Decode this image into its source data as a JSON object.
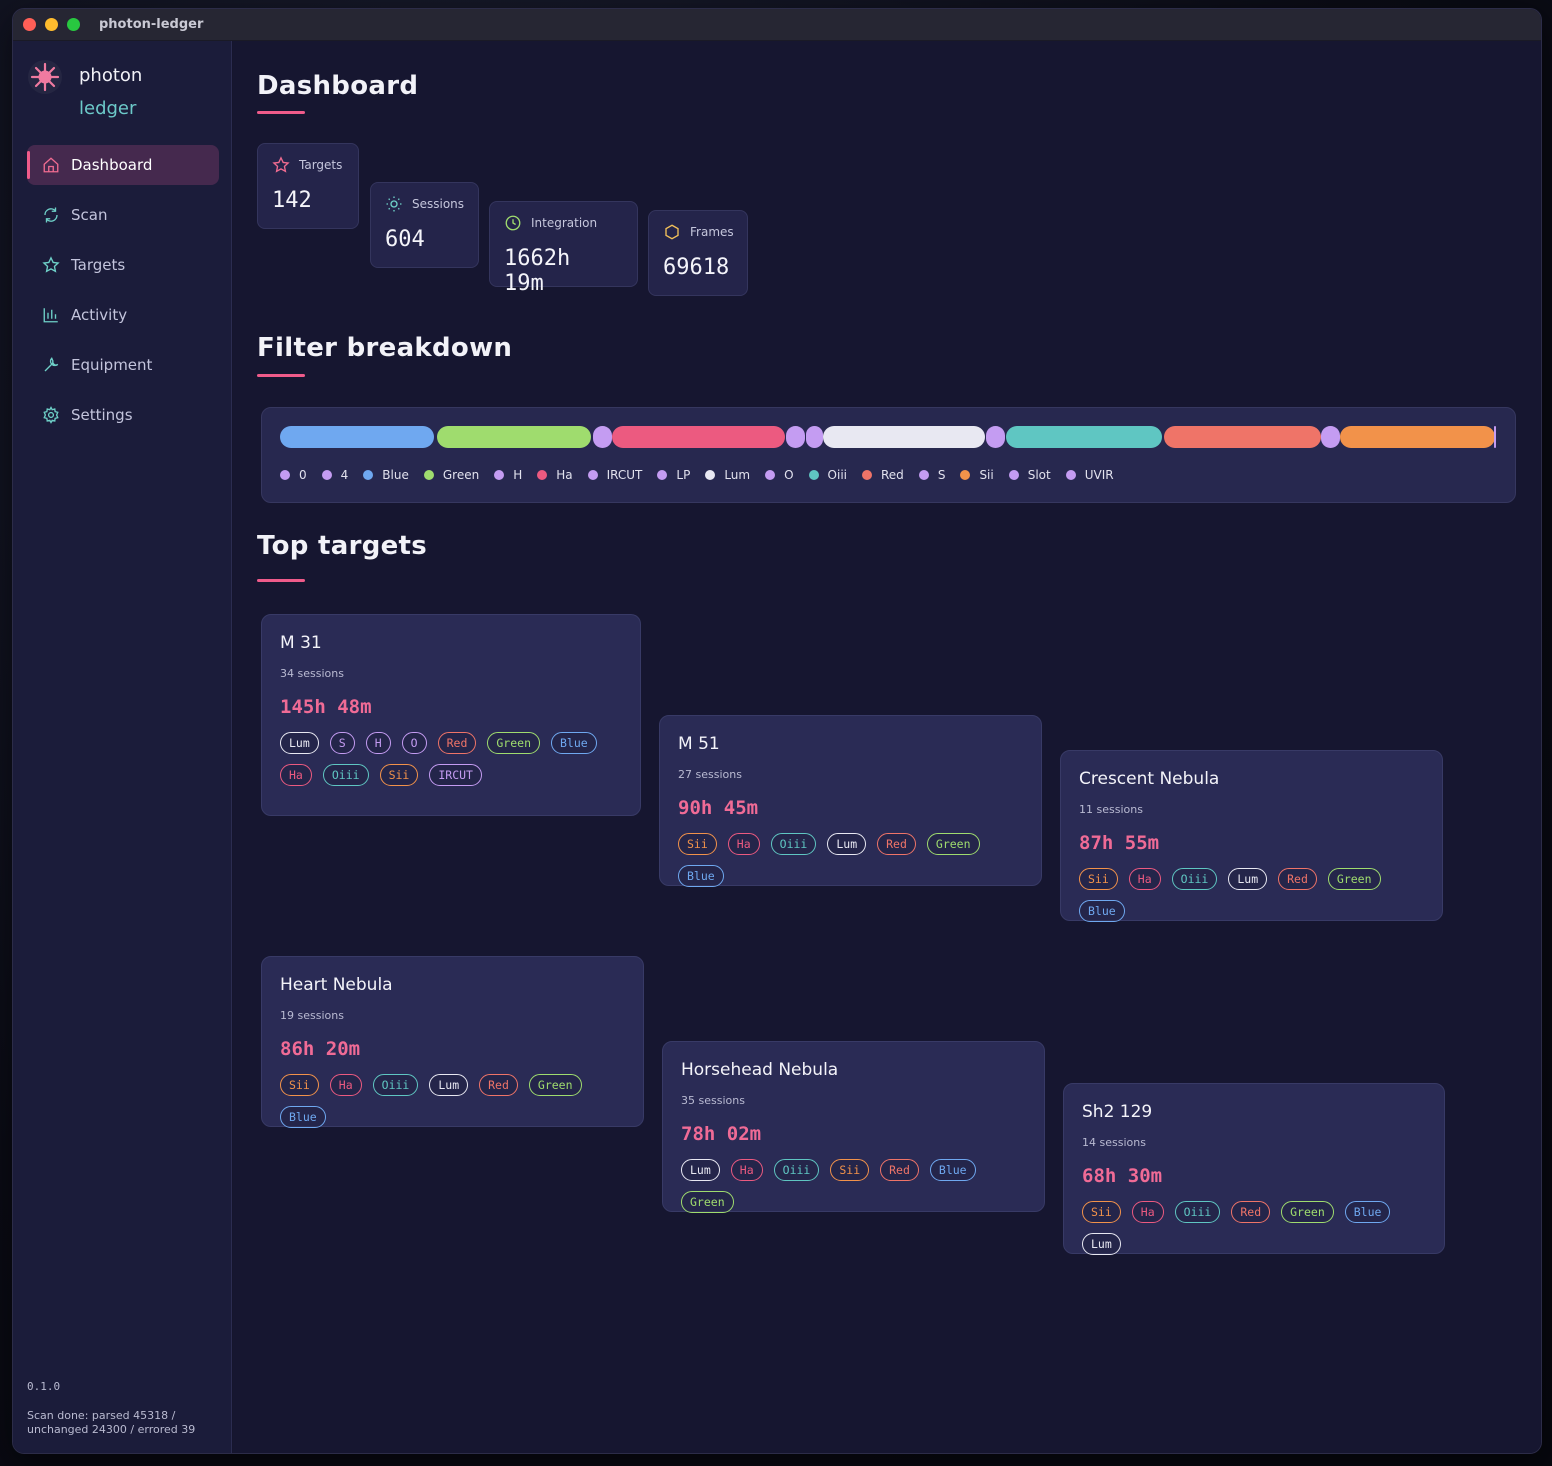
{
  "window": {
    "title": "photon-ledger"
  },
  "brand": {
    "line1": "photon",
    "line2": "ledger"
  },
  "nav": [
    {
      "label": "Dashboard",
      "icon": "home-icon",
      "active": true
    },
    {
      "label": "Scan",
      "icon": "refresh-icon",
      "active": false
    },
    {
      "label": "Targets",
      "icon": "star-icon",
      "active": false
    },
    {
      "label": "Activity",
      "icon": "bar-chart-icon",
      "active": false
    },
    {
      "label": "Equipment",
      "icon": "wrench-icon",
      "active": false
    },
    {
      "label": "Settings",
      "icon": "gear-icon",
      "active": false
    }
  ],
  "footer": {
    "version": "0.1.0",
    "scan_status": "Scan done: parsed 45318 / unchanged 24300 / errored 39"
  },
  "dashboard": {
    "title": "Dashboard",
    "stats": [
      {
        "label": "Targets",
        "value": "142",
        "icon": "star-icon",
        "color": "#ef6b90"
      },
      {
        "label": "Sessions",
        "value": "604",
        "icon": "sun-icon",
        "color": "#6ed0c8"
      },
      {
        "label": "Integration",
        "value": "1662h 19m",
        "icon": "clock-icon",
        "color": "#9fdc6e"
      },
      {
        "label": "Frames",
        "value": "69618",
        "icon": "hexagon-icon",
        "color": "#f2c05a"
      }
    ]
  },
  "filter_breakdown": {
    "title": "Filter breakdown",
    "legend": [
      {
        "name": "0",
        "color": "#c49cf2"
      },
      {
        "name": "4",
        "color": "#c49cf2"
      },
      {
        "name": "Blue",
        "color": "#6fa8f0"
      },
      {
        "name": "Green",
        "color": "#9fdc6e"
      },
      {
        "name": "H",
        "color": "#c49cf2"
      },
      {
        "name": "Ha",
        "color": "#ec5a80"
      },
      {
        "name": "IRCUT",
        "color": "#c49cf2"
      },
      {
        "name": "LP",
        "color": "#c49cf2"
      },
      {
        "name": "Lum",
        "color": "#e8e8f2"
      },
      {
        "name": "O",
        "color": "#c49cf2"
      },
      {
        "name": "Oiii",
        "color": "#5fc6c2"
      },
      {
        "name": "Red",
        "color": "#ef7468"
      },
      {
        "name": "S",
        "color": "#c49cf2"
      },
      {
        "name": "Sii",
        "color": "#f2924a"
      },
      {
        "name": "Slot",
        "color": "#c49cf2"
      },
      {
        "name": "UVIR",
        "color": "#c49cf2"
      }
    ]
  },
  "top_targets": {
    "title": "Top targets",
    "targets": [
      {
        "name": "M 31",
        "sessions": "34 sessions",
        "time": "145h 48m",
        "filters": [
          "Lum",
          "S",
          "H",
          "O",
          "Red",
          "Green",
          "Blue",
          "Ha",
          "Oiii",
          "Sii",
          "IRCUT"
        ]
      },
      {
        "name": "M 51",
        "sessions": "27 sessions",
        "time": "90h 45m",
        "filters": [
          "Sii",
          "Ha",
          "Oiii",
          "Lum",
          "Red",
          "Green",
          "Blue"
        ]
      },
      {
        "name": "Crescent Nebula",
        "sessions": "11 sessions",
        "time": "87h 55m",
        "filters": [
          "Sii",
          "Ha",
          "Oiii",
          "Lum",
          "Red",
          "Green",
          "Blue"
        ]
      },
      {
        "name": "Heart Nebula",
        "sessions": "19 sessions",
        "time": "86h 20m",
        "filters": [
          "Sii",
          "Ha",
          "Oiii",
          "Lum",
          "Red",
          "Green",
          "Blue"
        ]
      },
      {
        "name": "Horsehead Nebula",
        "sessions": "35 sessions",
        "time": "78h 02m",
        "filters": [
          "Lum",
          "Ha",
          "Oiii",
          "Sii",
          "Red",
          "Blue",
          "Green"
        ]
      },
      {
        "name": "Sh2 129",
        "sessions": "14 sessions",
        "time": "68h 30m",
        "filters": [
          "Sii",
          "Ha",
          "Oiii",
          "Red",
          "Green",
          "Blue",
          "Lum"
        ]
      }
    ]
  },
  "filter_colors": {
    "Lum": "#e8e8f2",
    "S": "#c49cf2",
    "H": "#c49cf2",
    "O": "#c49cf2",
    "IRCUT": "#c49cf2",
    "Red": "#ef7468",
    "Green": "#9fdc6e",
    "Blue": "#6fa8f0",
    "Ha": "#ec5a80",
    "Oiii": "#5fc6c2",
    "Sii": "#f2924a"
  }
}
